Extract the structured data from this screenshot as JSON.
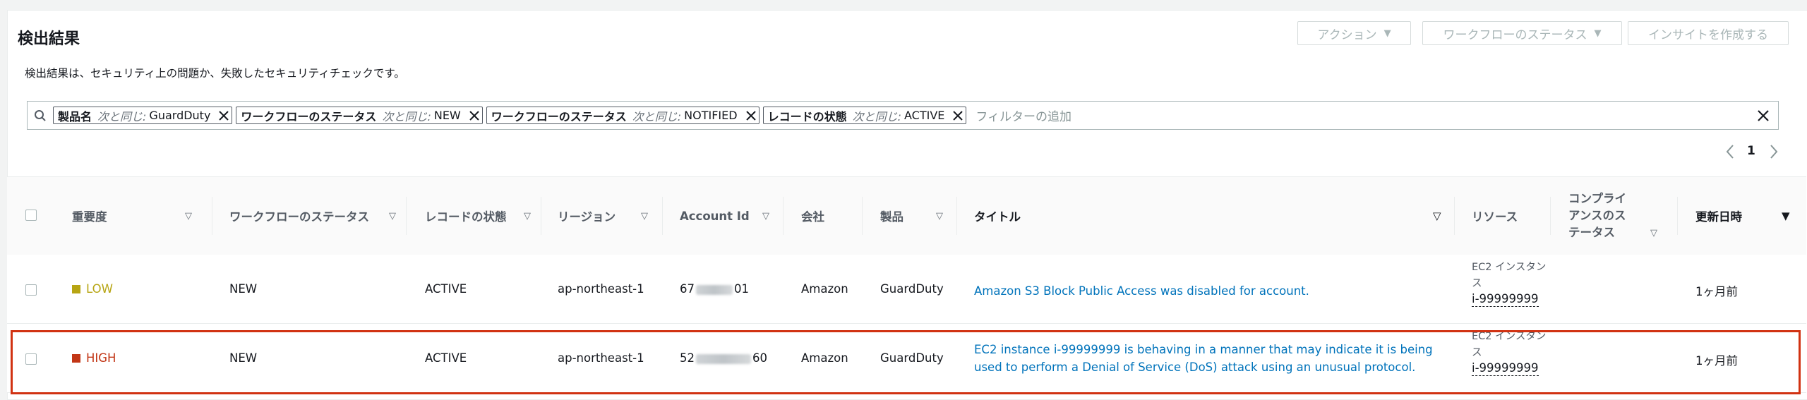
{
  "page": {
    "title": "検出結果",
    "description": "検出結果は、セキュリティ上の問題か、失敗したセキュリティチェックです。"
  },
  "header_buttons": {
    "actions": "アクション",
    "workflow_status": "ワークフローのステータス",
    "create_insight": "インサイトを作成する"
  },
  "filters": {
    "tokens": [
      {
        "key": "製品名",
        "op": "次と同じ:",
        "value": "GuardDuty"
      },
      {
        "key": "ワークフローのステータス",
        "op": "次と同じ:",
        "value": "NEW"
      },
      {
        "key": "ワークフローのステータス",
        "op": "次と同じ:",
        "value": "NOTIFIED"
      },
      {
        "key": "レコードの状態",
        "op": "次と同じ:",
        "value": "ACTIVE"
      }
    ],
    "placeholder": "フィルターの追加"
  },
  "pagination": {
    "current_page": "1"
  },
  "table": {
    "columns": {
      "severity": "重要度",
      "workflow_status": "ワークフローのステータス",
      "record_state": "レコードの状態",
      "region": "リージョン",
      "account_id": "Account Id",
      "company": "会社",
      "product": "製品",
      "title": "タイトル",
      "resource": "リソース",
      "compliance_line1": "コンプライ",
      "compliance_line2": "アンスのス",
      "compliance_line3": "テータス",
      "updated_at": "更新日時"
    },
    "rows": [
      {
        "severity": "LOW",
        "severity_color": "#b7a513",
        "workflow_status": "NEW",
        "record_state": "ACTIVE",
        "region": "ap-northeast-1",
        "account_prefix": "67",
        "account_suffix": "01",
        "company": "Amazon",
        "product": "GuardDuty",
        "title": "Amazon S3 Block Public Access was disabled for account.",
        "resource_type": "EC2 インスタンス",
        "resource_id": "i-99999999",
        "updated_at": "1ヶ月前"
      },
      {
        "severity": "HIGH",
        "severity_color": "#c23616",
        "workflow_status": "NEW",
        "record_state": "ACTIVE",
        "region": "ap-northeast-1",
        "account_prefix": "52",
        "account_suffix": "60",
        "company": "Amazon",
        "product": "GuardDuty",
        "title": "EC2 instance i-99999999 is behaving in a manner that may indicate it is being used to perform a Denial of Service (DoS) attack using an unusual protocol.",
        "resource_type": "EC2 インスタンス",
        "resource_id": "i-99999999",
        "updated_at": "1ヶ月前"
      }
    ]
  },
  "colors": {
    "link": "#0073bb",
    "highlight_border": "#d13212",
    "low": "#b7a513",
    "high": "#c23616"
  }
}
